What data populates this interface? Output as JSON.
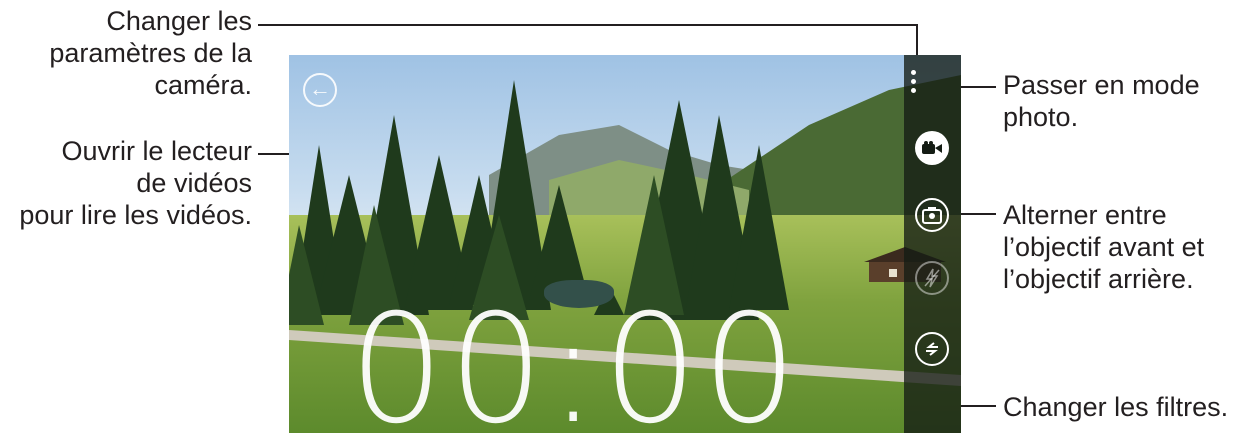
{
  "callouts": {
    "settings": "Changer les\nparamètres de la\ncaméra.",
    "video_player": "Ouvrir le lecteur\nde vidéos\npour lire les vidéos.",
    "photo_mode": "Passer en mode\nphoto.",
    "switch_lens": "Alterner entre\nl’objectif avant et\nl’objectif arrière.",
    "filters": "Changer les filtres."
  },
  "viewfinder": {
    "timer": "00:00"
  },
  "toolbar": {
    "buttons": [
      {
        "icon": "more-options-icon"
      },
      {
        "icon": "video-camera-icon"
      },
      {
        "icon": "switch-camera-icon"
      },
      {
        "icon": "flash-off-icon"
      },
      {
        "icon": "filters-icon"
      }
    ]
  },
  "colors": {
    "text": "#231f20",
    "toolbar": "#141c14",
    "icon": "#ffffff"
  }
}
